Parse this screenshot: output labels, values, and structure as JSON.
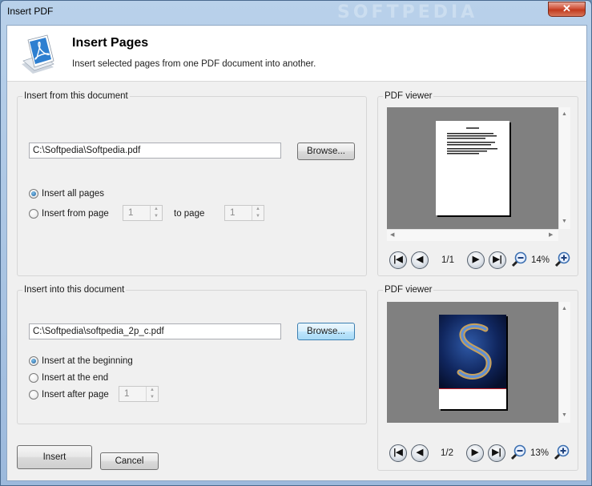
{
  "window": {
    "title": "Insert PDF",
    "close_label": "✕"
  },
  "header": {
    "title": "Insert Pages",
    "subtitle": "Insert selected pages from one PDF document into another."
  },
  "source": {
    "group_label": "Insert from this document",
    "path": "C:\\Softpedia\\Softpedia.pdf",
    "browse_label": "Browse...",
    "options": [
      {
        "label": "Insert all pages",
        "checked": true
      },
      {
        "label": "Insert from page",
        "checked": false
      }
    ],
    "from_page": "1",
    "to_page_label": "to page",
    "to_page": "1"
  },
  "target": {
    "group_label": "Insert into this document",
    "path": "C:\\Softpedia\\softpedia_2p_c.pdf",
    "browse_label": "Browse...",
    "options": [
      {
        "label": "Insert at the beginning",
        "checked": true
      },
      {
        "label": "Insert at the end",
        "checked": false
      },
      {
        "label": "Insert after page",
        "checked": false
      }
    ],
    "after_page": "1"
  },
  "viewer_top": {
    "label": "PDF viewer",
    "page_indicator": "1/1",
    "zoom": "14%"
  },
  "viewer_bottom": {
    "label": "PDF viewer",
    "page_indicator": "1/2",
    "zoom": "13%"
  },
  "footer": {
    "insert_label": "Insert",
    "cancel_label": "Cancel"
  },
  "nav": {
    "first": "|◀",
    "prev": "◀",
    "next": "▶",
    "last": "▶|"
  },
  "colors": {
    "title_bar": "#a8c3e2",
    "close_button": "#c13a1e",
    "viewer_background": "#808080"
  }
}
